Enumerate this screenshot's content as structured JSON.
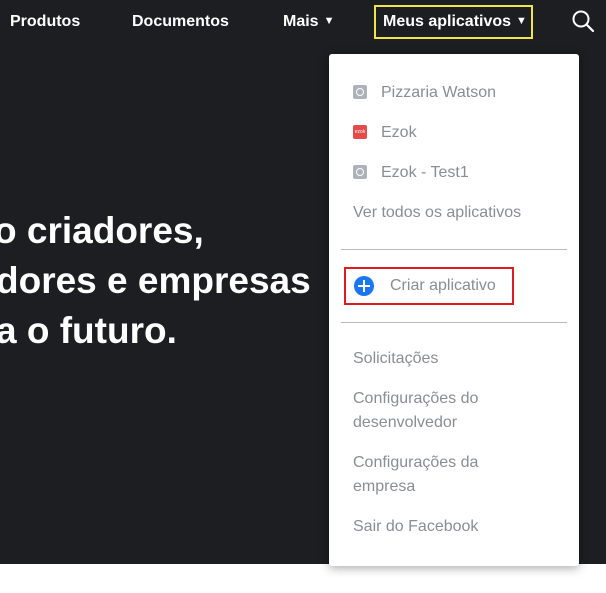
{
  "nav": {
    "products": "Produtos",
    "documents": "Documentos",
    "more": "Mais",
    "my_apps": "Meus aplicativos",
    "caret": "▼"
  },
  "hero": {
    "line1": "o criadores,",
    "line2": "dores e empresas",
    "line3": "a o futuro."
  },
  "dropdown": {
    "apps": [
      {
        "name": "Pizzaria Watson",
        "icon": "gear-icon"
      },
      {
        "name": "Ezok",
        "icon": "ezok-logo-icon",
        "icon_text": "ezok"
      },
      {
        "name": "Ezok - Test1",
        "icon": "gear-icon"
      }
    ],
    "see_all": "Ver todos os aplicativos",
    "create_app": "Criar aplicativo",
    "requests": "Solicitações",
    "developer_settings": "Configurações do desenvolvedor",
    "business_settings": "Configurações da empresa",
    "logout": "Sair do Facebook"
  },
  "colors": {
    "background": "#1c1e21",
    "highlight_box": "#f0e44a",
    "create_box": "#e01b22",
    "accent": "#1877f2",
    "menu_text": "#8a8d91"
  }
}
